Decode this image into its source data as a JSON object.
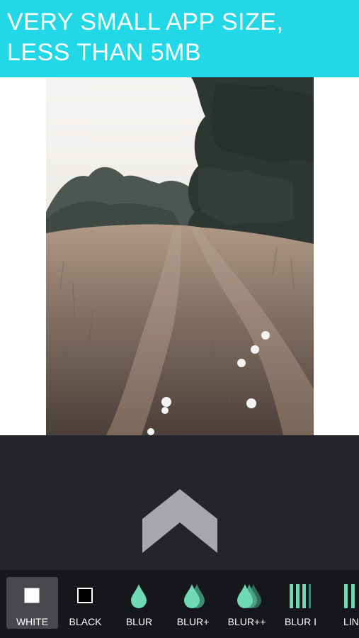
{
  "banner": {
    "line1": "VERY SMALL APP SIZE,",
    "line2": "LESS THAN 5MB",
    "background": "#22d7e6"
  },
  "photo": {
    "subject": "dirt-track-through-grass-photo"
  },
  "panel": {
    "toggle_icon": "chevron-up-icon",
    "toggle_color": "#a6a8ac"
  },
  "toolbar": {
    "accent": "#6fd9b3",
    "tools": [
      {
        "label": "WHITE",
        "icon": "white-square-icon",
        "selected": true
      },
      {
        "label": "BLACK",
        "icon": "black-square-icon",
        "selected": false
      },
      {
        "label": "BLUR",
        "icon": "drop-icon",
        "selected": false
      },
      {
        "label": "BLUR+",
        "icon": "double-drop-icon",
        "selected": false
      },
      {
        "label": "BLUR++",
        "icon": "triple-drop-icon",
        "selected": false
      },
      {
        "label": "BLUR I",
        "icon": "vertical-lines-icon",
        "selected": false
      },
      {
        "label": "LINE",
        "icon": "double-line-icon",
        "selected": false
      }
    ]
  }
}
